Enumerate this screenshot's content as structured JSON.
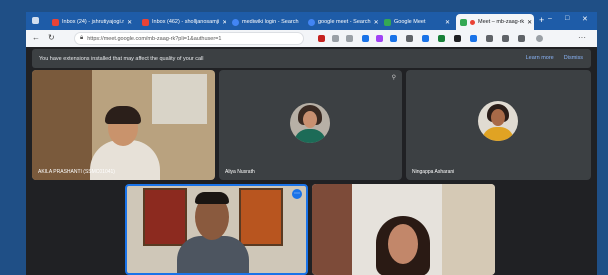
{
  "browser": {
    "tabs": [
      {
        "title": "Inbox (24) - jshrutiyajogi.r",
        "icon": "gmail-icon",
        "color": "#ea4335"
      },
      {
        "title": "Inbox (462) - sholljanosamji",
        "icon": "gmail-icon",
        "color": "#ea4335"
      },
      {
        "title": "mediwiki login - Search",
        "icon": "search-icon",
        "color": "#4285f4"
      },
      {
        "title": "google meet - Search",
        "icon": "search-icon",
        "color": "#4285f4"
      },
      {
        "title": "Google Meet",
        "icon": "meet-icon",
        "color": "#34a853"
      },
      {
        "title": "Meet – mb-zaag-rk",
        "icon": "meet-icon",
        "color": "#34a853"
      }
    ],
    "url": "https://meet.google.com/mb-zaag-rk?pli=1&authuser=1",
    "window_controls": {
      "minimize": "–",
      "maximize": "□",
      "close": "✕"
    }
  },
  "notice": {
    "message": "You have extensions installed that may affect the quality of your call",
    "learn_more": "Learn more",
    "dismiss": "Dismiss"
  },
  "participants": [
    {
      "name": "AKILA PRASHANTI (SSMC01041)"
    },
    {
      "name": "Aliya Nusrath"
    },
    {
      "name": "Ningappa Asharani"
    },
    {
      "name": ""
    },
    {
      "name": ""
    }
  ],
  "colors": {
    "accent": "#1a73e8",
    "tab_bar": "#1e5ca8",
    "meet_bg": "#202124",
    "tile_bg": "#3c4043"
  }
}
